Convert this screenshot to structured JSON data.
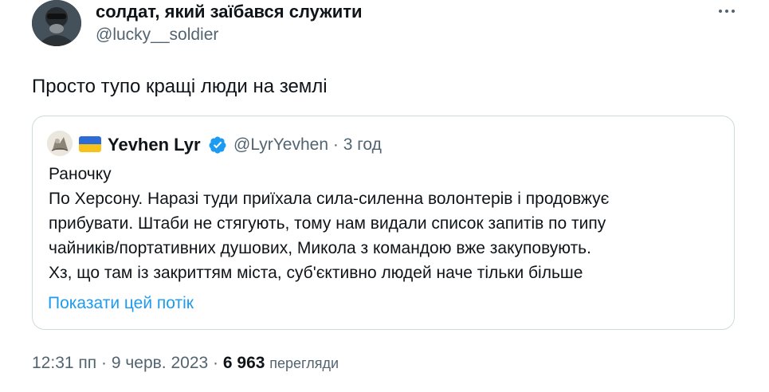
{
  "author": {
    "name": "солдат, який заїбався служити",
    "handle": "@lucky__soldier"
  },
  "tweet": {
    "text": "Просто тупо кращі люди на землі"
  },
  "quoted": {
    "name": "Yevhen Lyr",
    "handle": "@LyrYevhen",
    "separator": "·",
    "time": "3 год",
    "lines": [
      "Раночку",
      "По Херсону. Наразі туди приїхала сила-силенна волонтерів і продовжує",
      "прибувати. Штаби не стягують, тому нам видали список запитів по типу",
      "чайників/портативних душових, Микола з командою вже закуповують.",
      "Хз, що там із закриттям міста, суб'єктивно людей наче тільки більше"
    ],
    "show_thread": "Показати цей потік"
  },
  "footer": {
    "time": "12:31 пп",
    "sep1": "·",
    "date": "9 черв. 2023",
    "sep2": "·",
    "views_count": "6 963",
    "views_label": "перегляди"
  },
  "colors": {
    "text": "#0f1419",
    "secondary": "#536471",
    "link": "#1d9bf0",
    "border": "#cfd9de",
    "verified": "#1d9bf0"
  },
  "icons": {
    "more": "more-horizontal-icon",
    "verified": "verified-badge-icon",
    "flag": "ukraine-flag-icon"
  }
}
